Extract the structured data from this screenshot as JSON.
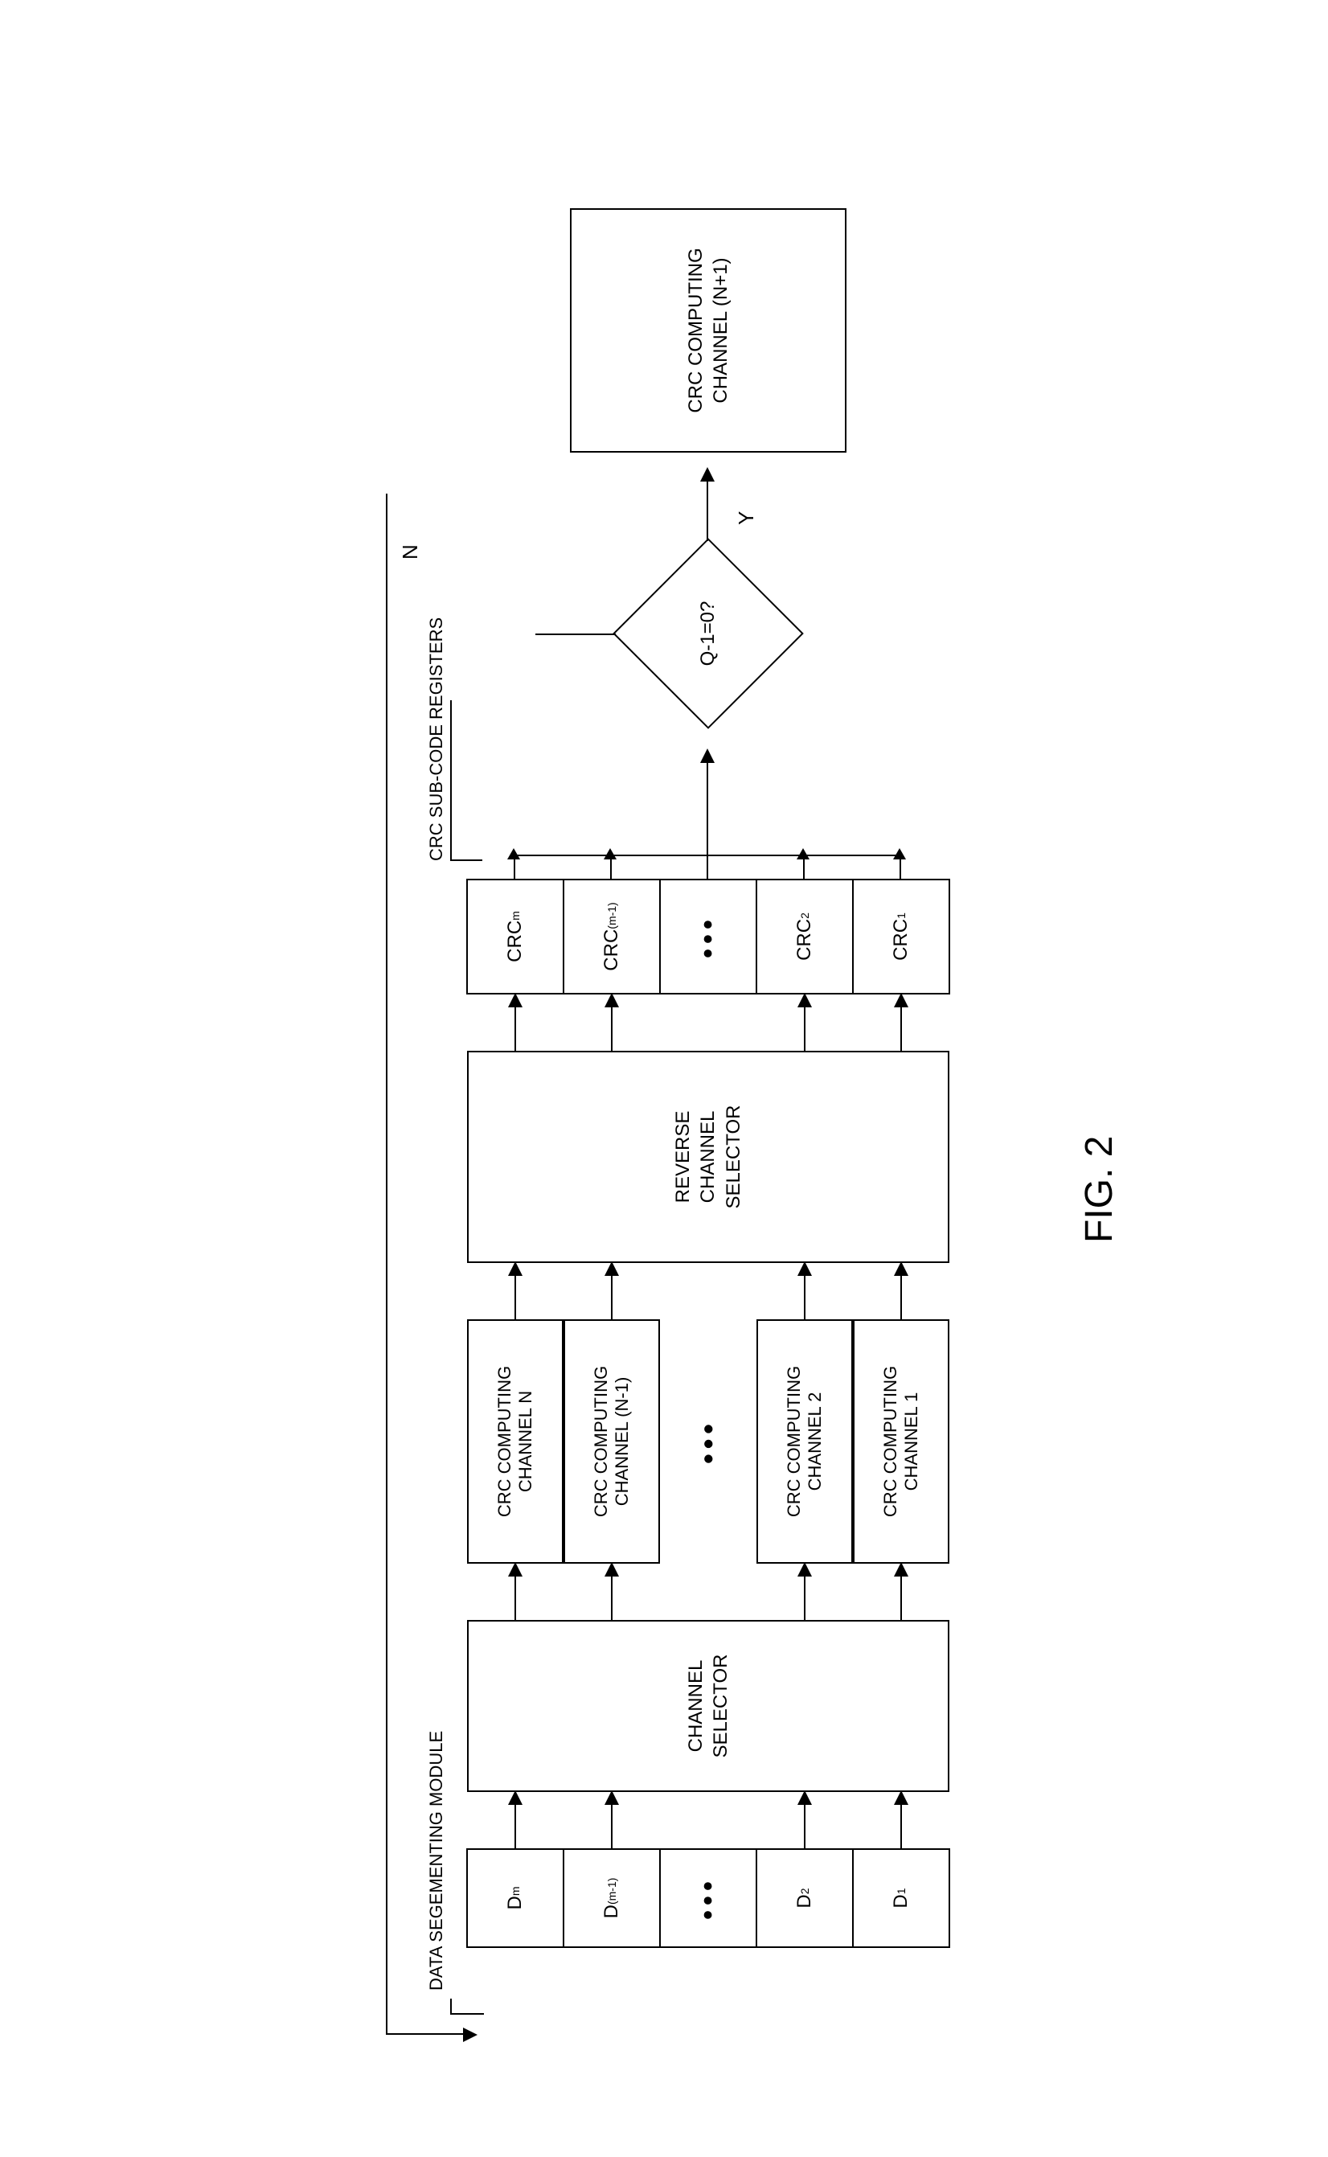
{
  "labels": {
    "data_segmenting": "DATA SEGEMENTING MODULE",
    "crc_registers": "CRC SUB-CODE REGISTERS",
    "channel_selector": "CHANNEL\nSELECTOR",
    "reverse_channel_selector": "REVERSE\nCHANNEL\nSELECTOR",
    "final_channel": "CRC COMPUTING\nCHANNEL (N+1)",
    "decision": "Q-1=0?",
    "decision_no": "N",
    "decision_yes": "Y",
    "figure": "FIG. 2",
    "ellipsis": "•••"
  },
  "data_segments": {
    "top": {
      "base": "D",
      "sub": "m"
    },
    "second": {
      "base": "D",
      "sub": "(m-1)"
    },
    "fourth": {
      "base": "D",
      "sub": "2"
    },
    "bottom": {
      "base": "D",
      "sub": "1"
    }
  },
  "compute_channels": {
    "top": "CRC COMPUTING\nCHANNEL N",
    "second": "CRC COMPUTING\nCHANNEL (N-1)",
    "fourth": "CRC COMPUTING\nCHANNEL 2",
    "bottom": "CRC COMPUTING\nCHANNEL 1"
  },
  "crc_registers": {
    "top": {
      "base": "CRC",
      "sub": "m"
    },
    "second": {
      "base": "CRC",
      "sub": "(m-1)"
    },
    "fourth": {
      "base": "CRC",
      "sub": "2"
    },
    "bottom": {
      "base": "CRC",
      "sub": "1"
    }
  }
}
